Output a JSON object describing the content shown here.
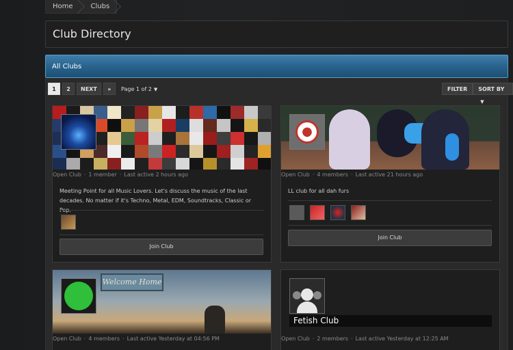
{
  "breadcrumb": {
    "home": "Home",
    "clubs": "Clubs"
  },
  "page_title": "Club Directory",
  "section": {
    "title": "All Clubs"
  },
  "pagination": {
    "pages": [
      "1",
      "2"
    ],
    "next": "NEXT",
    "last": "»",
    "page_of": "Page 1 of 2"
  },
  "toolbar": {
    "filter": "FILTER",
    "sort": "SORT BY"
  },
  "clubs": [
    {
      "type": "Open Club",
      "members": "1 member",
      "activity": "Last active 2 hours ago",
      "description": "Meeting Point for all Music Lovers. Let's discuss the music of the last decades. No matter if it's Techno, Metal, EDM, Soundtracks, Classic or Pop.",
      "join": "Join Club"
    },
    {
      "type": "Open Club",
      "members": "4 members",
      "activity": "Last active 21 hours ago",
      "description": "LL club for all dah furs",
      "join": "Join Club"
    },
    {
      "type": "Open Club",
      "members": "4 members",
      "activity": "Last active Yesterday at 04:56 PM",
      "banner_sign": "Welcome Home"
    },
    {
      "type": "Open Club",
      "members": "2 members",
      "activity": "Last active Yesterday at 12:25 AM",
      "name": "Fetish Club"
    }
  ],
  "icons": {
    "paw": "paw-icon",
    "user": "user-placeholder-icon",
    "caret": "caret-down-icon"
  },
  "colors": {
    "header_blue": "#2b6690",
    "accent_red": "#c0342c",
    "green_logo": "#2fbf3a"
  }
}
